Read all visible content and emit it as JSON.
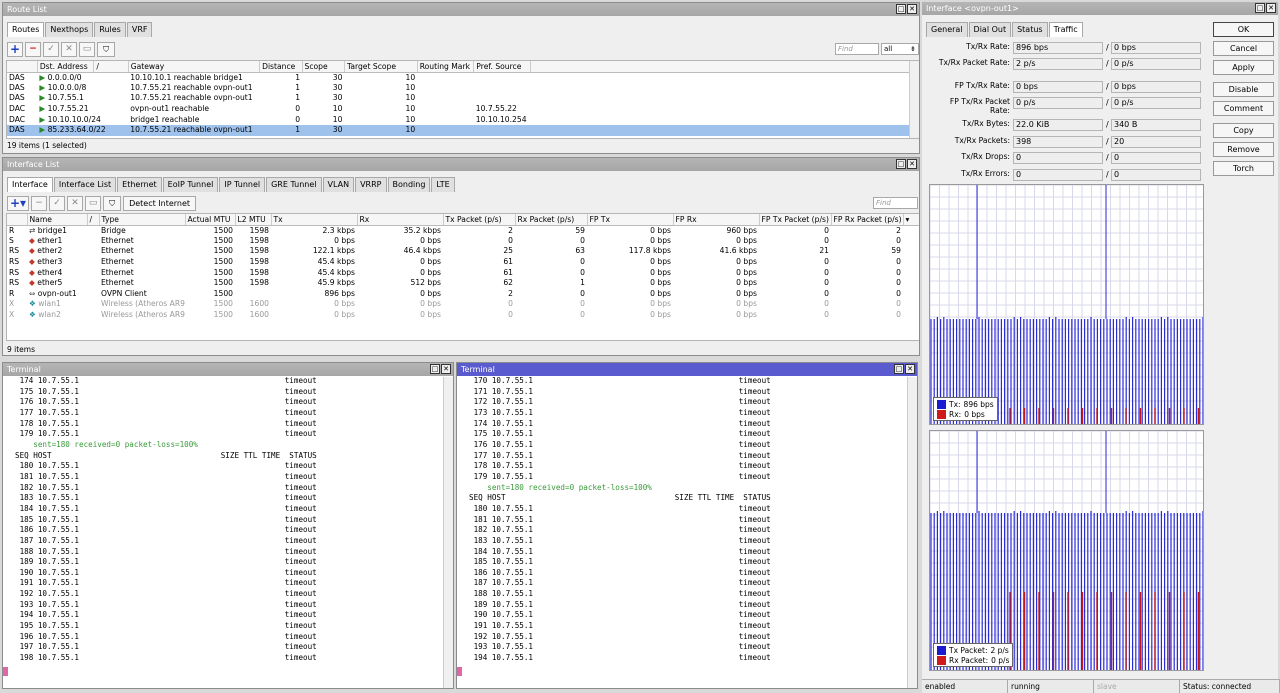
{
  "route_list": {
    "title": "Route List",
    "tabs": [
      "Routes",
      "Nexthops",
      "Rules",
      "VRF"
    ],
    "find_placeholder": "Find",
    "filter": "all",
    "columns": [
      "",
      "Dst. Address",
      "/",
      "Gateway",
      "Distance",
      "Scope",
      "Target Scope",
      "Routing Mark",
      "Pref. Source"
    ],
    "rows": [
      [
        "DAS",
        "0.0.0.0/0",
        "10.10.10.1 reachable bridge1",
        "1",
        "30",
        "10",
        "",
        ""
      ],
      [
        "DAS",
        "10.0.0.0/8",
        "10.7.55.21 reachable ovpn-out1",
        "1",
        "30",
        "10",
        "",
        ""
      ],
      [
        "DAS",
        "10.7.55.1",
        "10.7.55.21 reachable ovpn-out1",
        "1",
        "30",
        "10",
        "",
        ""
      ],
      [
        "DAC",
        "10.7.55.21",
        "ovpn-out1 reachable",
        "0",
        "10",
        "10",
        "",
        "10.7.55.22"
      ],
      [
        "DAC",
        "10.10.10.0/24",
        "bridge1 reachable",
        "0",
        "10",
        "10",
        "",
        "10.10.10.254"
      ],
      [
        "DAS",
        "85.233.64.0/22",
        "10.7.55.21 reachable ovpn-out1",
        "1",
        "30",
        "10",
        "",
        ""
      ]
    ],
    "status": "19 items (1 selected)"
  },
  "interface_list": {
    "title": "Interface List",
    "tabs": [
      "Interface",
      "Interface List",
      "Ethernet",
      "EoIP Tunnel",
      "IP Tunnel",
      "GRE Tunnel",
      "VLAN",
      "VRRP",
      "Bonding",
      "LTE"
    ],
    "detect_btn": "Detect Internet",
    "find_placeholder": "Find",
    "columns": [
      "",
      "Name",
      "/",
      "Type",
      "Actual MTU",
      "L2 MTU",
      "Tx",
      "Rx",
      "Tx Packet (p/s)",
      "Rx Packet (p/s)",
      "FP Tx",
      "FP Rx",
      "FP Tx Packet (p/s)",
      "FP Rx Packet (p/s)"
    ],
    "rows": [
      [
        "R",
        "⇄",
        "bridge1",
        "Bridge",
        "1500",
        "1598",
        "2.3 kbps",
        "35.2 kbps",
        "2",
        "59",
        "0 bps",
        "960 bps",
        "0",
        "2"
      ],
      [
        "S",
        "◆",
        "ether1",
        "Ethernet",
        "1500",
        "1598",
        "0 bps",
        "0 bps",
        "0",
        "0",
        "0 bps",
        "0 bps",
        "0",
        "0"
      ],
      [
        "RS",
        "◆",
        "ether2",
        "Ethernet",
        "1500",
        "1598",
        "122.1 kbps",
        "46.4 kbps",
        "25",
        "63",
        "117.8 kbps",
        "41.6 kbps",
        "21",
        "59"
      ],
      [
        "RS",
        "◆",
        "ether3",
        "Ethernet",
        "1500",
        "1598",
        "45.4 kbps",
        "0 bps",
        "61",
        "0",
        "0 bps",
        "0 bps",
        "0",
        "0"
      ],
      [
        "RS",
        "◆",
        "ether4",
        "Ethernet",
        "1500",
        "1598",
        "45.4 kbps",
        "0 bps",
        "61",
        "0",
        "0 bps",
        "0 bps",
        "0",
        "0"
      ],
      [
        "RS",
        "◆",
        "ether5",
        "Ethernet",
        "1500",
        "1598",
        "45.9 kbps",
        "512 bps",
        "62",
        "1",
        "0 bps",
        "0 bps",
        "0",
        "0"
      ],
      [
        "R",
        "⇔",
        "ovpn-out1",
        "OVPN Client",
        "1500",
        "",
        "896 bps",
        "0 bps",
        "2",
        "0",
        "0 bps",
        "0 bps",
        "0",
        "0"
      ],
      [
        "X",
        "❖",
        "wlan1",
        "Wireless (Atheros AR9...",
        "1500",
        "1600",
        "0 bps",
        "0 bps",
        "0",
        "0",
        "0 bps",
        "0 bps",
        "0",
        "0"
      ],
      [
        "X",
        "❖",
        "wlan2",
        "Wireless (Atheros AR9...",
        "1500",
        "1600",
        "0 bps",
        "0 bps",
        "0",
        "0",
        "0 bps",
        "0 bps",
        "0",
        "0"
      ]
    ],
    "status": "9 items"
  },
  "terminal_left": {
    "title": "Terminal",
    "lines": [
      " 174 10.7.55.1                                             timeout",
      " 175 10.7.55.1                                             timeout",
      " 176 10.7.55.1                                             timeout",
      " 177 10.7.55.1                                             timeout",
      " 178 10.7.55.1                                             timeout",
      " 179 10.7.55.1                                             timeout",
      "    sent=180 received=0 packet-loss=100%",
      "SEQ HOST                                     SIZE TTL TIME  STATUS",
      " 180 10.7.55.1                                             timeout",
      " 181 10.7.55.1                                             timeout",
      " 182 10.7.55.1                                             timeout",
      " 183 10.7.55.1                                             timeout",
      " 184 10.7.55.1                                             timeout",
      " 185 10.7.55.1                                             timeout",
      " 186 10.7.55.1                                             timeout",
      " 187 10.7.55.1                                             timeout",
      " 188 10.7.55.1                                             timeout",
      " 189 10.7.55.1                                             timeout",
      " 190 10.7.55.1                                             timeout",
      " 191 10.7.55.1                                             timeout",
      " 192 10.7.55.1                                             timeout",
      " 193 10.7.55.1                                             timeout",
      " 194 10.7.55.1                                             timeout",
      " 195 10.7.55.1                                             timeout",
      " 196 10.7.55.1                                             timeout",
      " 197 10.7.55.1                                             timeout",
      " 198 10.7.55.1                                             timeout"
    ]
  },
  "terminal_right": {
    "title": "Terminal",
    "lines": [
      " 170 10.7.55.1                                             timeout",
      " 171 10.7.55.1                                             timeout",
      " 172 10.7.55.1                                             timeout",
      " 173 10.7.55.1                                             timeout",
      " 174 10.7.55.1                                             timeout",
      " 175 10.7.55.1                                             timeout",
      " 176 10.7.55.1                                             timeout",
      " 177 10.7.55.1                                             timeout",
      " 178 10.7.55.1                                             timeout",
      " 179 10.7.55.1                                             timeout",
      "    sent=180 received=0 packet-loss=100%",
      "SEQ HOST                                     SIZE TTL TIME  STATUS",
      " 180 10.7.55.1                                             timeout",
      " 181 10.7.55.1                                             timeout",
      " 182 10.7.55.1                                             timeout",
      " 183 10.7.55.1                                             timeout",
      " 184 10.7.55.1                                             timeout",
      " 185 10.7.55.1                                             timeout",
      " 186 10.7.55.1                                             timeout",
      " 187 10.7.55.1                                             timeout",
      " 188 10.7.55.1                                             timeout",
      " 189 10.7.55.1                                             timeout",
      " 190 10.7.55.1                                             timeout",
      " 191 10.7.55.1                                             timeout",
      " 192 10.7.55.1                                             timeout",
      " 193 10.7.55.1                                             timeout",
      " 194 10.7.55.1                                             timeout"
    ]
  },
  "iface_window": {
    "title": "Interface <ovpn-out1>",
    "tabs": [
      "General",
      "Dial Out",
      "Status",
      "Traffic"
    ],
    "fields": [
      {
        "label": "Tx/Rx Rate:",
        "a": "896 bps",
        "b": "0 bps"
      },
      {
        "label": "Tx/Rx Packet Rate:",
        "a": "2 p/s",
        "b": "0 p/s"
      },
      {
        "label": "FP Tx/Rx Rate:",
        "a": "0 bps",
        "b": "0 bps"
      },
      {
        "label": "FP Tx/Rx Packet Rate:",
        "a": "0 p/s",
        "b": "0 p/s"
      },
      {
        "label": "Tx/Rx Bytes:",
        "a": "22.0 KiB",
        "b": "340 B"
      },
      {
        "label": "Tx/Rx Packets:",
        "a": "398",
        "b": "20"
      },
      {
        "label": "Tx/Rx Drops:",
        "a": "0",
        "b": "0"
      },
      {
        "label": "Tx/Rx Errors:",
        "a": "0",
        "b": "0"
      }
    ],
    "buttons": [
      "OK",
      "Cancel",
      "Apply",
      "Disable",
      "Comment",
      "Copy",
      "Remove",
      "Torch"
    ],
    "legend1": [
      {
        "label": "Tx:",
        "value": "896 bps",
        "color": "#1a1ad0"
      },
      {
        "label": "Rx:",
        "value": "0 bps",
        "color": "#d01a1a"
      }
    ],
    "legend2": [
      {
        "label": "Tx Packet:",
        "value": "2 p/s",
        "color": "#1a1ad0"
      },
      {
        "label": "Rx Packet:",
        "value": "0 p/s",
        "color": "#d01a1a"
      }
    ],
    "status": [
      "enabled",
      "running",
      "slave",
      "Status: connected"
    ]
  }
}
